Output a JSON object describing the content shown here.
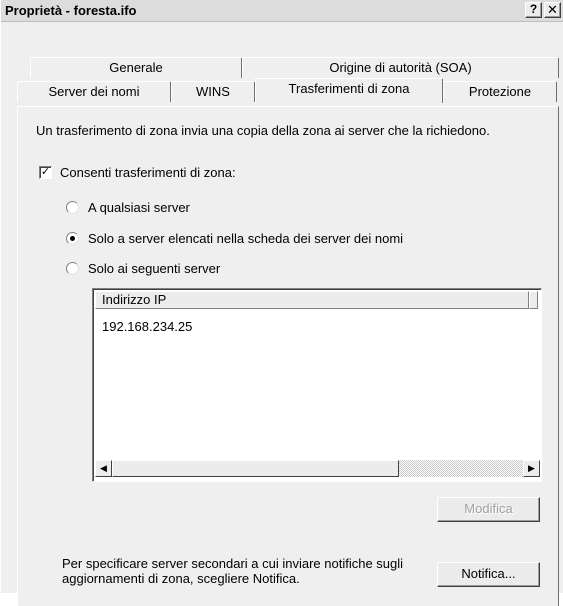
{
  "window": {
    "title": "Proprietà - foresta.ifo",
    "help_label": "?",
    "close_label": "✕"
  },
  "tabs": {
    "back_row": [
      {
        "label": "Generale"
      },
      {
        "label": "Origine di autorità (SOA)"
      }
    ],
    "front_row": [
      {
        "label": "Server dei nomi"
      },
      {
        "label": "WINS"
      },
      {
        "label": "Trasferimenti di zona",
        "selected": true
      },
      {
        "label": "Protezione"
      }
    ]
  },
  "main": {
    "description": "Un trasferimento di zona invia una copia della zona ai server che la richiedono.",
    "allow_checkbox": {
      "label": "Consenti trasferimenti di zona:",
      "checked": true,
      "mark": "✓"
    },
    "radios": [
      {
        "label": "A qualsiasi server",
        "selected": false
      },
      {
        "label": "Solo a server elencati nella scheda dei server dei nomi",
        "selected": true
      },
      {
        "label": "Solo ai seguenti server",
        "selected": false
      }
    ],
    "ip_list": {
      "column_header": "Indirizzo IP",
      "rows": [
        "192.168.234.25"
      ],
      "scroll_left_glyph": "◀",
      "scroll_right_glyph": "▶"
    },
    "modify_button": {
      "label": "Modifica",
      "disabled": true
    },
    "notify_text": "Per specificare server secondari a cui inviare notifiche sugli aggiornamenti di zona, scegliere Notifica.",
    "notify_button": {
      "label": "Notifica..."
    }
  }
}
